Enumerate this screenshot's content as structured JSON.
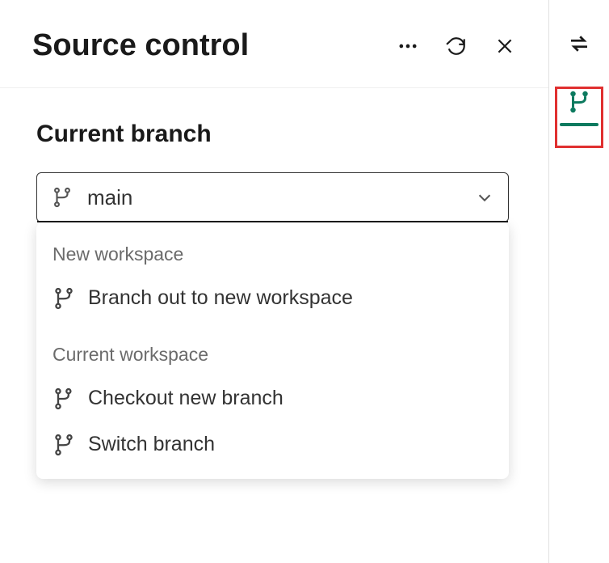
{
  "header": {
    "title": "Source control"
  },
  "section": {
    "label": "Current branch"
  },
  "branch": {
    "selected": "main"
  },
  "dropdown": {
    "sections": [
      {
        "label": "New workspace",
        "items": [
          {
            "label": "Branch out to new workspace",
            "icon": "branch-icon"
          }
        ]
      },
      {
        "label": "Current workspace",
        "items": [
          {
            "label": "Checkout new branch",
            "icon": "branch-new-icon"
          },
          {
            "label": "Switch branch",
            "icon": "branch-icon"
          }
        ]
      }
    ]
  }
}
